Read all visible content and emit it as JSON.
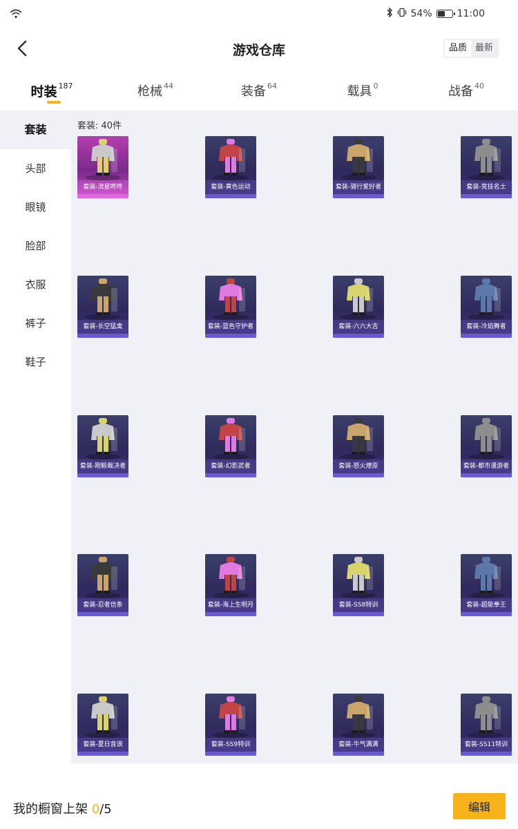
{
  "status": {
    "battery_text": "54%",
    "time": "11:00",
    "battery_level": 0.54
  },
  "header": {
    "title": "游戏仓库",
    "sort_options": [
      "品质",
      "最新"
    ],
    "sort_selected": "品质"
  },
  "tabs": [
    {
      "label": "时装",
      "count": "187",
      "active": true
    },
    {
      "label": "枪械",
      "count": "44",
      "active": false
    },
    {
      "label": "装备",
      "count": "64",
      "active": false
    },
    {
      "label": "载具",
      "count": "0",
      "active": false
    },
    {
      "label": "战备",
      "count": "40",
      "active": false
    }
  ],
  "sidenav": {
    "items": [
      "套装",
      "头部",
      "眼镜",
      "脸部",
      "衣服",
      "裤子",
      "鞋子"
    ],
    "active_index": 0
  },
  "content": {
    "count_label": "套装: 40件",
    "items": [
      {
        "name": "套装-流星咚咚",
        "rarity": "legendary"
      },
      {
        "name": "套装-黄色运动",
        "rarity": "epic"
      },
      {
        "name": "套装-骑行爱好者",
        "rarity": "epic"
      },
      {
        "name": "套装-竞技名士",
        "rarity": "epic"
      },
      {
        "name": "套装-长空猛禽",
        "rarity": "epic"
      },
      {
        "name": "套装-蓝色守护者",
        "rarity": "epic"
      },
      {
        "name": "套装-六六大吉",
        "rarity": "epic"
      },
      {
        "name": "套装-冷焰舞者",
        "rarity": "epic"
      },
      {
        "name": "套装-刚毅裁决者",
        "rarity": "epic"
      },
      {
        "name": "套装-幻影武者",
        "rarity": "epic"
      },
      {
        "name": "套装-怒火燎原",
        "rarity": "epic"
      },
      {
        "name": "套装-都市漫游者",
        "rarity": "epic"
      },
      {
        "name": "套装-忍者信条",
        "rarity": "epic"
      },
      {
        "name": "套装-海上生明月",
        "rarity": "epic"
      },
      {
        "name": "套装-SS8特训",
        "rarity": "epic"
      },
      {
        "name": "套装-超能拳王",
        "rarity": "epic"
      },
      {
        "name": "套装-夏日音浪",
        "rarity": "epic"
      },
      {
        "name": "套装-SS9特训",
        "rarity": "epic"
      },
      {
        "name": "套装-牛气满满",
        "rarity": "epic"
      },
      {
        "name": "套装-SS11特训",
        "rarity": "epic"
      }
    ]
  },
  "bottom": {
    "label": "我的橱窗上架 ",
    "count": "0",
    "total": "/5",
    "edit_label": "编辑"
  },
  "colors": {
    "accent": "#f6b41a",
    "card_epic": "#3a2e73",
    "card_legendary": "#b53fb0",
    "content_bg": "#f0f1f6"
  }
}
